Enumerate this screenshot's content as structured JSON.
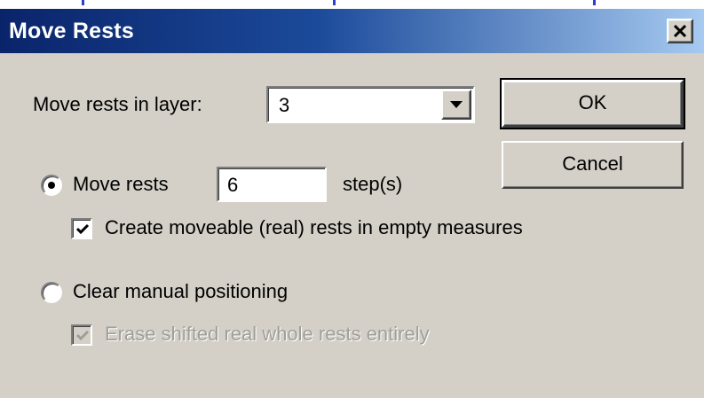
{
  "dialog": {
    "title": "Move Rests",
    "layer_label": "Move rests in layer:",
    "layer_value": "3",
    "ok_label": "OK",
    "cancel_label": "Cancel",
    "move_rests_label": "Move rests",
    "move_rests_steps": "6",
    "steps_suffix": "step(s)",
    "create_rests_label": "Create moveable (real) rests in empty measures",
    "clear_positioning_label": "Clear manual positioning",
    "erase_shifted_label": "Erase shifted real whole rests entirely"
  },
  "state": {
    "move_rests_selected": true,
    "clear_positioning_selected": false,
    "create_rests_checked": true,
    "erase_shifted_checked": true,
    "erase_shifted_disabled": true
  },
  "colors": {
    "title_start": "#0a246a",
    "title_end": "#a6caf0",
    "face": "#d4d0c8"
  },
  "icons": {
    "close": "close-icon",
    "dropdown": "chevron-down-icon",
    "check": "checkmark-icon"
  }
}
